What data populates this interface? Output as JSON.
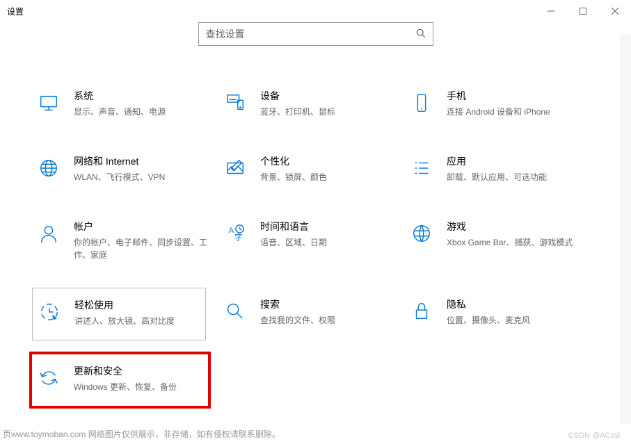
{
  "window": {
    "title": "设置"
  },
  "search": {
    "placeholder": "查找设置"
  },
  "tiles": [
    {
      "title": "系统",
      "sub": "显示、声音、通知、电源"
    },
    {
      "title": "设备",
      "sub": "蓝牙、打印机、鼠标"
    },
    {
      "title": "手机",
      "sub": "连接 Android 设备和 iPhone"
    },
    {
      "title": "网络和 Internet",
      "sub": "WLAN、飞行模式、VPN"
    },
    {
      "title": "个性化",
      "sub": "背景、锁屏、颜色"
    },
    {
      "title": "应用",
      "sub": "卸载、默认应用、可选功能"
    },
    {
      "title": "帐户",
      "sub": "你的帐户、电子邮件、同步设置、工作、家庭"
    },
    {
      "title": "时间和语言",
      "sub": "语音、区域、日期"
    },
    {
      "title": "游戏",
      "sub": "Xbox Game Bar、捕获、游戏模式"
    },
    {
      "title": "轻松使用",
      "sub": "讲述人、放大镜、高对比度"
    },
    {
      "title": "搜索",
      "sub": "查找我的文件、权限"
    },
    {
      "title": "隐私",
      "sub": "位置、摄像头、麦克风"
    },
    {
      "title": "更新和安全",
      "sub": "Windows 更新、恢复、备份"
    }
  ],
  "watermark": "CSDN @ACzsl",
  "footer": "页www.toymoban.com 网络图片仅供展示，非存储，如有侵权请联系删除。"
}
